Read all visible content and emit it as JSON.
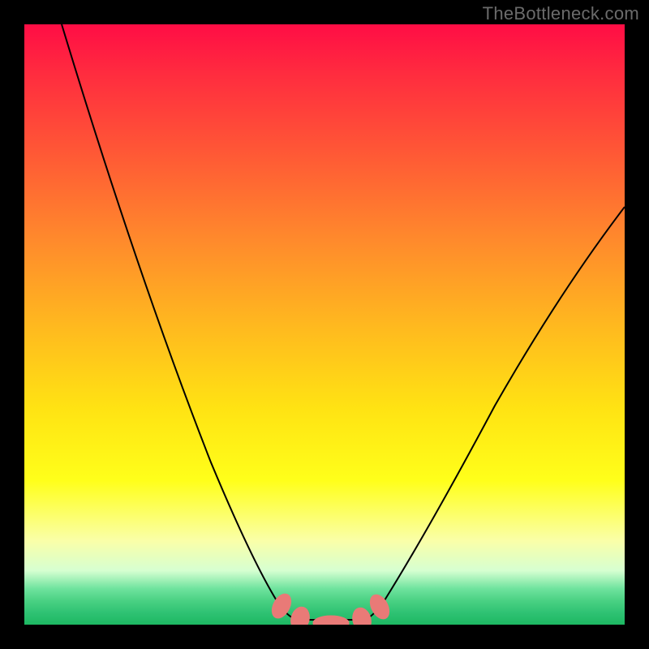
{
  "watermark": "TheBottleneck.com",
  "chart_data": {
    "type": "line",
    "title": "",
    "xlabel": "",
    "ylabel": "",
    "x": [
      0.0,
      0.05,
      0.1,
      0.15,
      0.2,
      0.25,
      0.3,
      0.35,
      0.4,
      0.42,
      0.45,
      0.5,
      0.55,
      0.58,
      0.6,
      0.65,
      0.7,
      0.75,
      0.8,
      0.85,
      0.9,
      0.95,
      1.0
    ],
    "values": [
      null,
      1.0,
      0.83,
      0.66,
      0.49,
      0.33,
      0.19,
      0.09,
      0.03,
      0.01,
      0.0,
      0.0,
      0.0,
      0.01,
      0.03,
      0.09,
      0.17,
      0.27,
      0.37,
      0.47,
      0.56,
      0.63,
      0.7
    ],
    "xlim": [
      0,
      1
    ],
    "ylim": [
      0,
      1
    ],
    "background_gradient": [
      "#ff0d45",
      "#ffff1a",
      "#1db862"
    ],
    "markers": [
      {
        "x": 0.42,
        "y": 0.01,
        "color": "#e97a77"
      },
      {
        "x": 0.45,
        "y": 0.0,
        "color": "#e97a77"
      },
      {
        "x": 0.5,
        "y": 0.0,
        "color": "#e97a77"
      },
      {
        "x": 0.55,
        "y": 0.0,
        "color": "#e97a77"
      },
      {
        "x": 0.58,
        "y": 0.01,
        "color": "#e97a77"
      }
    ]
  }
}
